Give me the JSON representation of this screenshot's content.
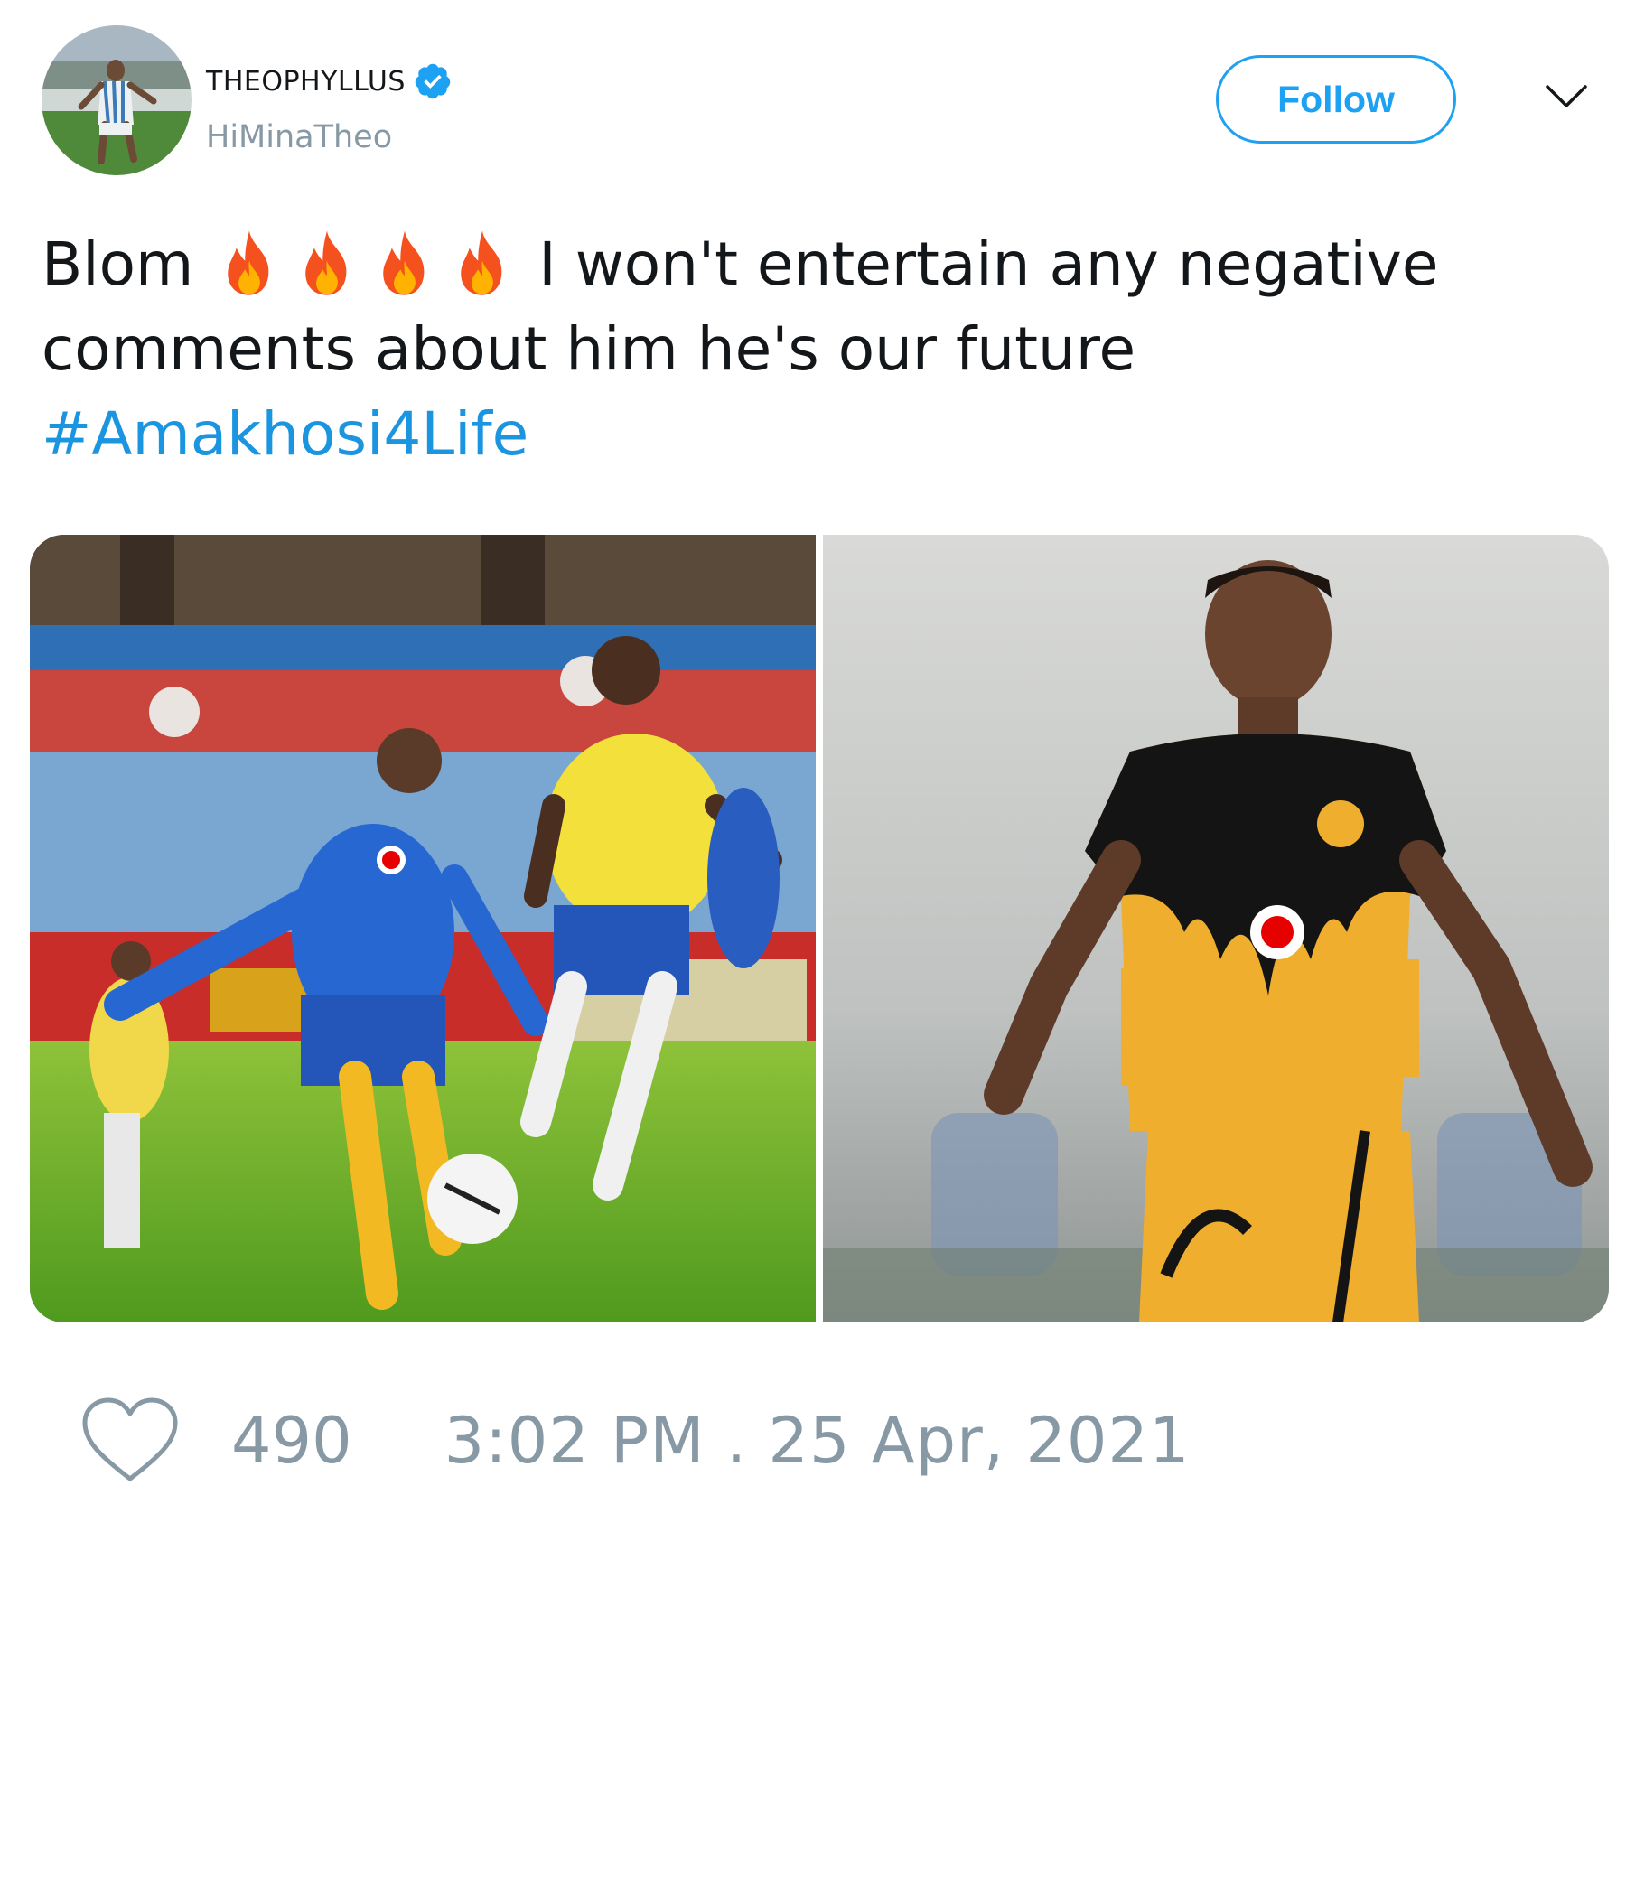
{
  "tweet": {
    "author": {
      "display_name": "THEOPHYLLUS",
      "handle": "HiMinaTheo",
      "verified": true,
      "avatar_icon": "avatar-photo"
    },
    "follow_label": "Follow",
    "text_before": "Blom",
    "fire_emoji_count": 4,
    "text_after": "I won't entertain any negative comments about him he's our future",
    "hashtag": "#Amakhosi4Life",
    "media": [
      {
        "kind": "photo",
        "icon": "football-action-photo"
      },
      {
        "kind": "photo",
        "icon": "football-portrait-photo"
      }
    ],
    "like_count": "490",
    "timestamp": "3:02 PM . 25 Apr, 2021"
  },
  "colors": {
    "accent": "#1da1f2",
    "hashtag": "#1b95e0",
    "muted": "#8899a6",
    "text": "#14171a"
  }
}
